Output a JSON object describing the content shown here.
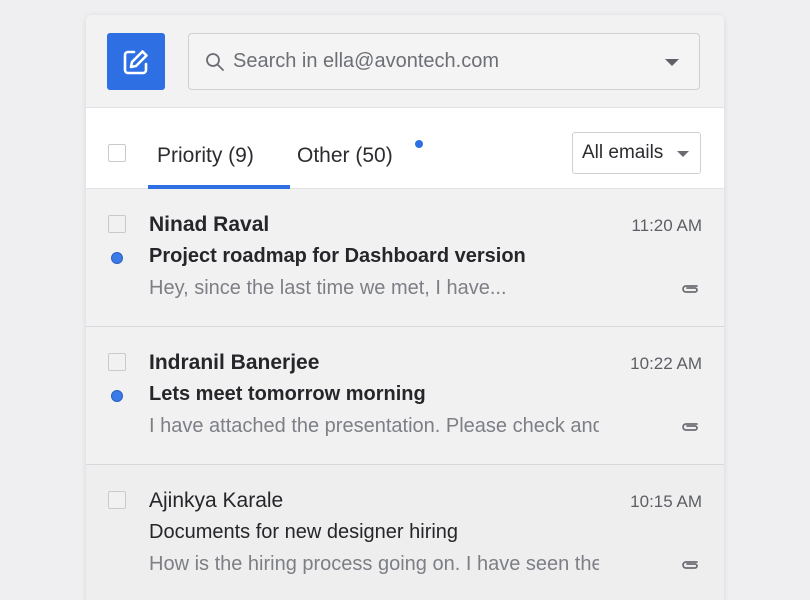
{
  "search": {
    "placeholder": "Search in ella@avontech.com"
  },
  "tabs": [
    {
      "label": "Priority (9)",
      "active": true
    },
    {
      "label": "Other (50)",
      "active": false,
      "has_new": true
    }
  ],
  "filter": {
    "selected": "All emails"
  },
  "colors": {
    "accent": "#2f6fe4",
    "unread_dot": "#3a7be8"
  },
  "emails": [
    {
      "sender": "Ninad Raval",
      "time": "11:20 AM",
      "subject": "Project roadmap for Dashboard version",
      "preview": "Hey, since the last time we met, I have...",
      "unread": true,
      "attachment_icon": "paperclip-icon"
    },
    {
      "sender": "Indranil Banerjee",
      "time": "10:22 AM",
      "subject": "Lets meet tomorrow morning",
      "preview": "I have attached the presentation. Please check and...",
      "unread": true,
      "attachment_icon": "paperclip-icon"
    },
    {
      "sender": "Ajinkya Karale",
      "time": "10:15 AM",
      "subject": "Documents for new designer hiring",
      "preview": "How is the hiring process going on. I have seen the...",
      "unread": false,
      "attachment_icon": "paperclip-icon"
    }
  ]
}
